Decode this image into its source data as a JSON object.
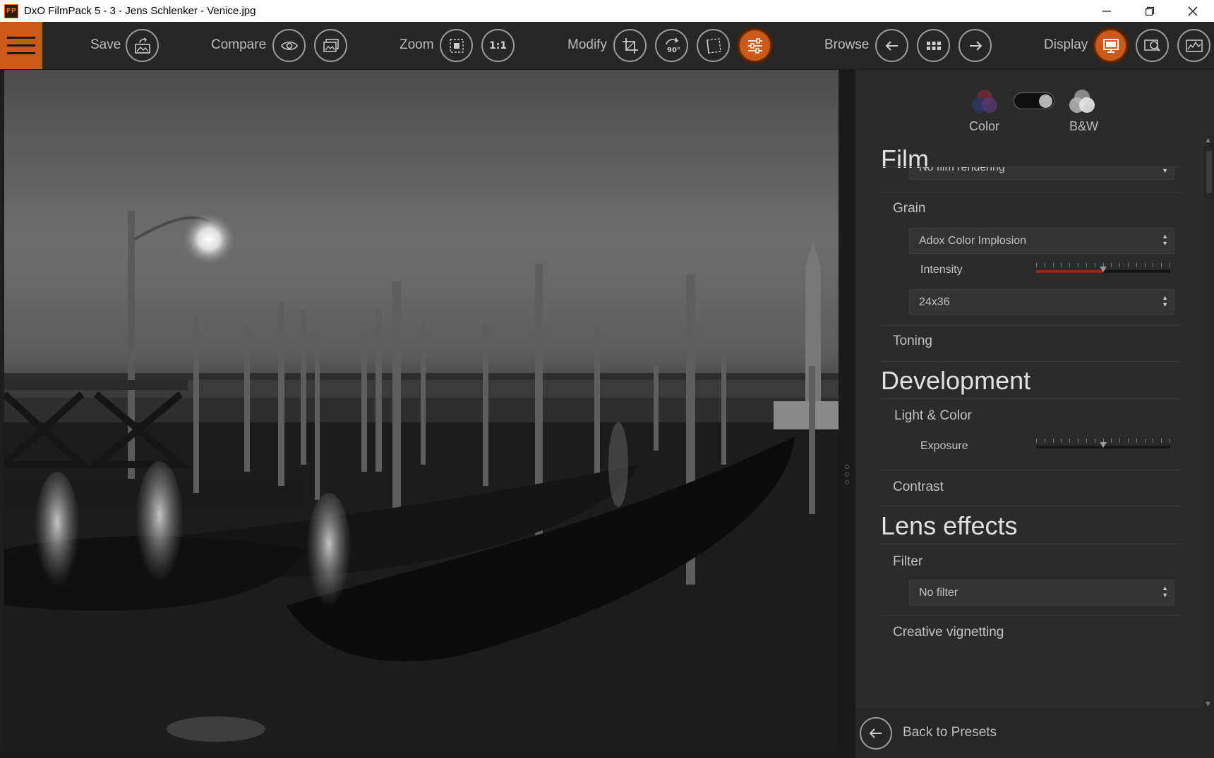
{
  "window": {
    "app_icon": "FP",
    "title": "DxO FilmPack 5 - 3 - Jens Schlenker - Venice.jpg",
    "controls": [
      "minimize-icon",
      "restore-icon",
      "close-icon"
    ]
  },
  "toolbar": {
    "menu_icon": "hamburger-menu-icon",
    "save_label": "Save",
    "compare_label": "Compare",
    "zoom_label": "Zoom",
    "zoom_1to1": "1:1",
    "modify_label": "Modify",
    "rotate_label": "90°",
    "browse_label": "Browse",
    "display_label": "Display",
    "accent_color": "#c95a1a"
  },
  "panel": {
    "mode": {
      "color_label": "Color",
      "bw_label": "B&W",
      "selected": "B&W"
    },
    "film": {
      "title": "Film",
      "rendering_value": "No film rendering",
      "grain_title": "Grain",
      "grain_value": "Adox Color Implosion",
      "intensity_label": "Intensity",
      "intensity_value": 0.5,
      "format_value": "24x36",
      "toning_title": "Toning"
    },
    "development": {
      "title": "Development",
      "light_color_title": "Light & Color",
      "exposure_label": "Exposure",
      "exposure_value": 0.5,
      "contrast_title": "Contrast"
    },
    "lens_effects": {
      "title": "Lens effects",
      "filter_title": "Filter",
      "filter_value": "No filter",
      "vignetting_title": "Creative vignetting"
    },
    "back_label": "Back to Presets"
  }
}
